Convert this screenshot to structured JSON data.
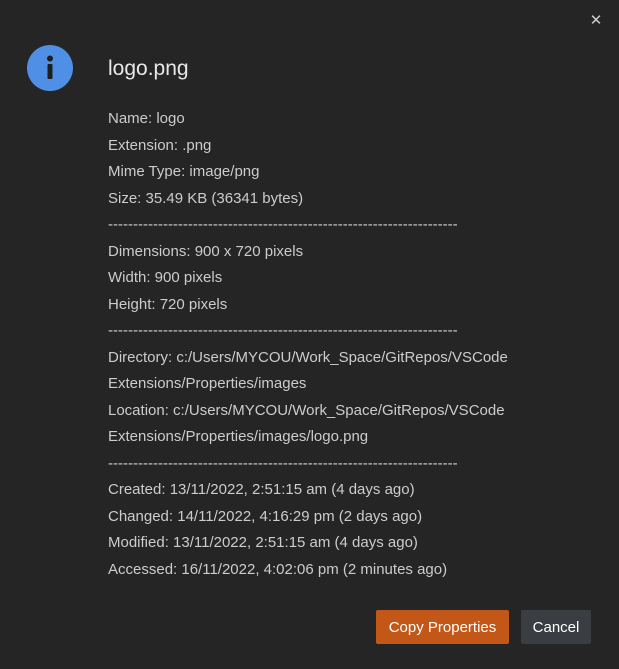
{
  "dialog": {
    "close_glyph": "✕",
    "icon": "info-icon",
    "icon_glyph": "i",
    "icon_color": "#4f8fe6",
    "title": "logo.png",
    "lines": [
      "Name: logo",
      "Extension: .png",
      "Mime Type: image/png",
      "Size: 35.49 KB (36341 bytes)",
      "----------------------------------------------------------------------",
      "Dimensions: 900 x 720 pixels",
      "Width: 900 pixels",
      "Height: 720 pixels",
      "----------------------------------------------------------------------",
      "Directory: c:/Users/MYCOU/Work_Space/GitRepos/VSCode",
      "Extensions/Properties/images",
      "Location: c:/Users/MYCOU/Work_Space/GitRepos/VSCode",
      "Extensions/Properties/images/logo.png",
      "----------------------------------------------------------------------",
      "Created: 13/11/2022, 2:51:15 am (4 days ago)",
      "Changed: 14/11/2022, 4:16:29 pm (2 days ago)",
      "Modified: 13/11/2022, 2:51:15 am (4 days ago)",
      "Accessed: 16/11/2022, 4:02:06 pm (2 minutes ago)"
    ],
    "buttons": {
      "copy_label": "Copy Properties",
      "cancel_label": "Cancel",
      "primary_color": "#c25717",
      "secondary_color": "#3a3d41"
    }
  }
}
